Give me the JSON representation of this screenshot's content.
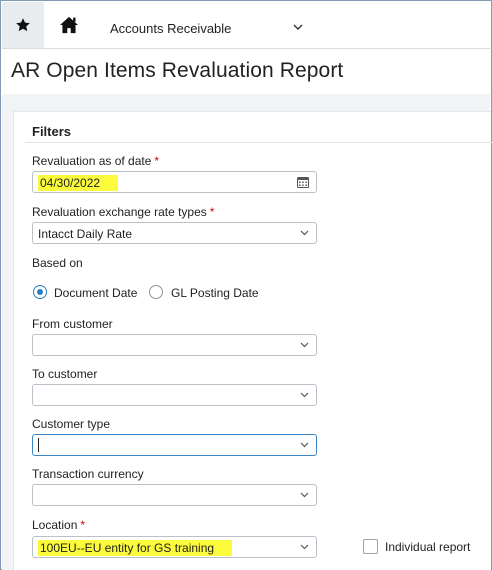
{
  "nav": {
    "module": "Accounts Receivable",
    "icons": {
      "favorites": "star-icon",
      "home": "home-icon",
      "module_menu": "chevron-down-icon"
    }
  },
  "page": {
    "title": "AR Open Items Revaluation Report"
  },
  "filters": {
    "title": "Filters",
    "revaluation_date": {
      "label": "Revaluation as of date",
      "required_mark": "*",
      "value": "04/30/2022",
      "icon": "calendar-icon"
    },
    "rate_types": {
      "label": "Revaluation exchange rate types",
      "required_mark": "*",
      "value": "Intacct Daily Rate"
    },
    "based_on": {
      "label": "Based on",
      "options": [
        {
          "label": "Document Date",
          "selected": true
        },
        {
          "label": "GL Posting Date",
          "selected": false
        }
      ]
    },
    "from_customer": {
      "label": "From customer",
      "value": ""
    },
    "to_customer": {
      "label": "To customer",
      "value": ""
    },
    "customer_type": {
      "label": "Customer type",
      "value": ""
    },
    "transaction_currency": {
      "label": "Transaction currency",
      "value": ""
    },
    "location": {
      "label": "Location",
      "required_mark": "*",
      "value": "100EU--EU entity for GS training"
    },
    "individual_report": {
      "label": "Individual report",
      "checked": false
    }
  },
  "colors": {
    "highlight": "#fbfb3c",
    "required": "#d0021b",
    "accent": "#2a7fc1"
  }
}
